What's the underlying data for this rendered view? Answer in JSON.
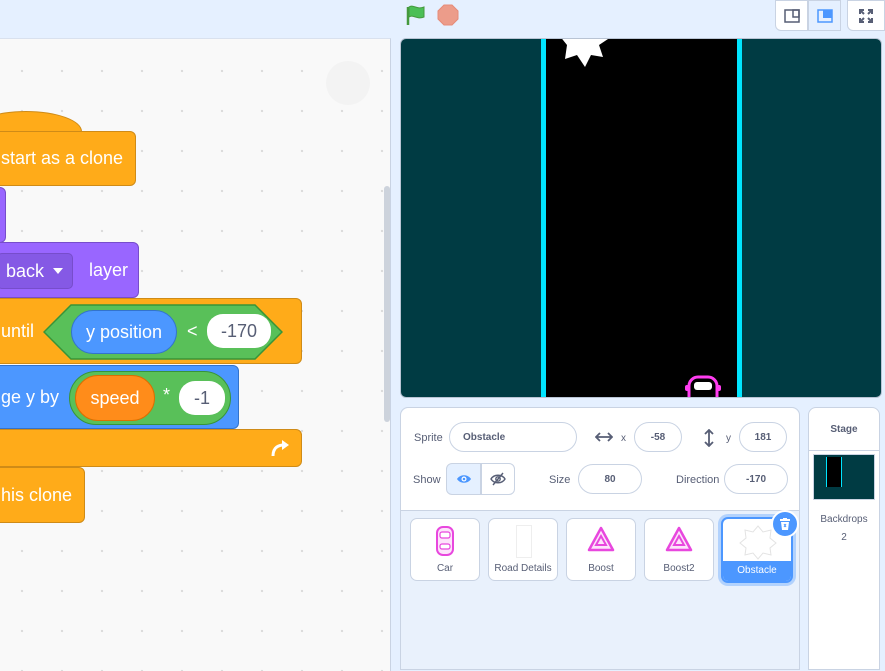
{
  "toolbar": {
    "green_flag": "green-flag-icon",
    "stop": "stop-icon"
  },
  "code": {
    "hat_label": "start as a clone",
    "layer_dropdown": "back",
    "layer_suffix": "layer",
    "repeat_prefix": "until",
    "y_position": "y position",
    "lt_op": "<",
    "y_limit": "-170",
    "change_prefix": "ge y by",
    "speed_var": "speed",
    "mul_op": "*",
    "mul_value": "-1",
    "delete_label": "his clone"
  },
  "sprite_info": {
    "sprite_label": "Sprite",
    "sprite_name": "Obstacle",
    "x_label": "x",
    "x_value": "-58",
    "y_label": "y",
    "y_value": "181",
    "show_label": "Show",
    "size_label": "Size",
    "size_value": "80",
    "direction_label": "Direction",
    "direction_value": "-170"
  },
  "sprites": [
    {
      "name": "Car",
      "icon": "car-icon"
    },
    {
      "name": "Road Details",
      "icon": "road-icon"
    },
    {
      "name": "Boost",
      "icon": "boost-icon"
    },
    {
      "name": "Boost2",
      "icon": "boost-icon"
    },
    {
      "name": "Obstacle",
      "icon": "obstacle-icon",
      "selected": true
    }
  ],
  "stage_panel": {
    "title": "Stage",
    "backdrops_label": "Backdrops",
    "backdrops_count": "2"
  },
  "colors": {
    "events": "#ffab19",
    "looks": "#9966ff",
    "operators": "#59c059",
    "motion": "#4c97ff",
    "variables": "#ff8c1a",
    "stage_bg": "#003b43",
    "road": "#000000",
    "lane_line": "#00e5ff",
    "selected": "#4c97ff"
  }
}
